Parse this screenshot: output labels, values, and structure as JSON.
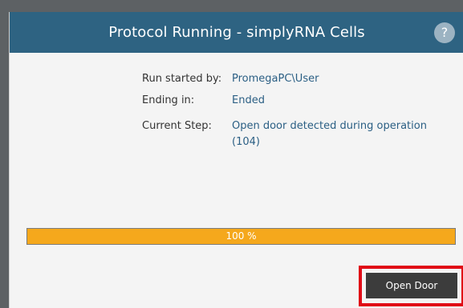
{
  "dialog": {
    "title": "Protocol Running - simplyRNA Cells",
    "help_icon": "help-icon",
    "help_label": "?"
  },
  "info": {
    "run_started_by_label": "Run started by:",
    "run_started_by_value": "PromegaPC\\User",
    "ending_in_label": "Ending in:",
    "ending_in_value": "Ended",
    "current_step_label": "Current Step:",
    "current_step_value": "Open door detected during operation (104)"
  },
  "progress": {
    "percent": 100,
    "text": "100 %"
  },
  "actions": {
    "open_door_label": "Open Door"
  },
  "colors": {
    "titlebar": "#2e6382",
    "progress": "#f4a71d",
    "highlight": "#e00a16",
    "link_text": "#2b5f84"
  }
}
